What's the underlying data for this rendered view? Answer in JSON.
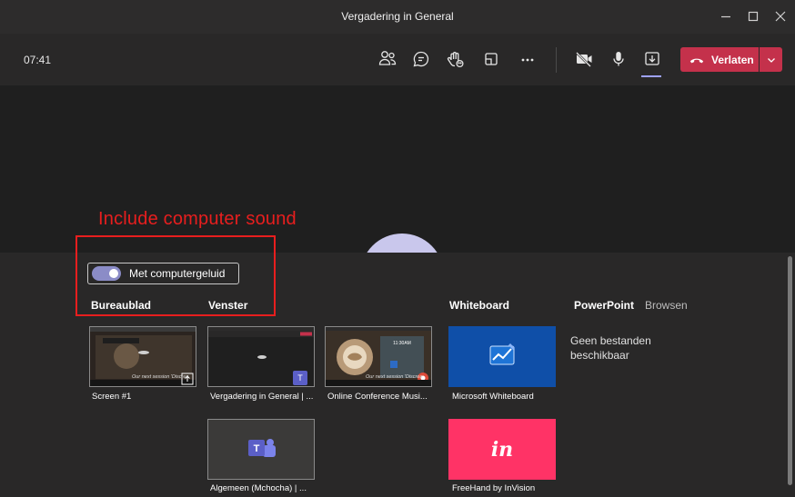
{
  "window": {
    "title": "Vergadering in General",
    "controls": [
      "minimize-icon",
      "maximize-icon",
      "close-icon"
    ]
  },
  "toolbar": {
    "clock": "07:41",
    "icons": [
      "participants-icon",
      "chat-icon",
      "raise-hand-icon",
      "rooms-icon",
      "more-icon",
      "camera-off-icon",
      "microphone-icon",
      "share-tray-icon"
    ],
    "leave_label": "Verlaten",
    "leave_color": "#c4314b"
  },
  "annotation": {
    "text": "Include computer sound",
    "color": "#e81e1e"
  },
  "share": {
    "computer_sound_label": "Met computergeluid",
    "computer_sound_on": true,
    "sections": {
      "desktop": "Bureaublad",
      "window": "Venster",
      "whiteboard": "Whiteboard",
      "powerpoint": "PowerPoint",
      "browse": "Browsen"
    },
    "desktop_tiles": [
      {
        "label": "Screen #1"
      }
    ],
    "window_tiles": [
      {
        "label": "Vergadering in General | ..."
      },
      {
        "label": "Online Conference Musi..."
      },
      {
        "label": "Algemeen (Mchocha) | ..."
      }
    ],
    "whiteboard_tiles": [
      {
        "label": "Microsoft Whiteboard",
        "bg": "#0f4fa8"
      },
      {
        "label": "FreeHand by InVision",
        "bg": "#ff3366",
        "logo_text": "in"
      }
    ],
    "powerpoint_empty": "Geen bestanden beschikbaar",
    "thumb_caption": "Our next session 'Discrea"
  },
  "accent_color": "#8b8cc7"
}
